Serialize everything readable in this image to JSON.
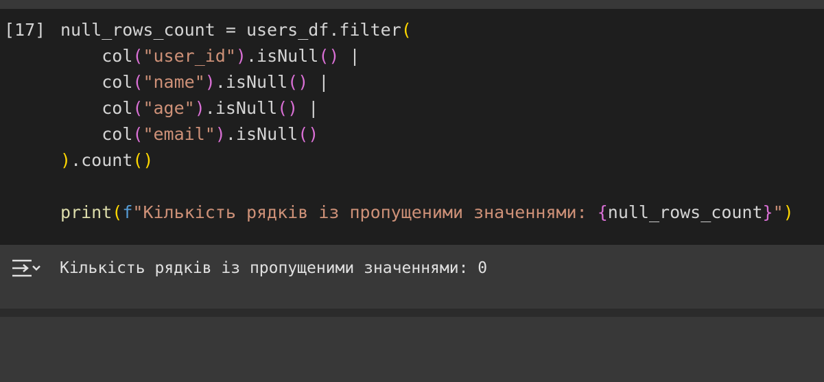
{
  "cell": {
    "execution_count": "[17]",
    "code": {
      "line1": {
        "var": "null_rows_count",
        "assign": " = ",
        "obj": "users_df",
        "dot": ".",
        "method": "filter",
        "open": "("
      },
      "line2": {
        "indent": "    ",
        "fn": "col",
        "open": "(",
        "arg": "\"user_id\"",
        "close": ")",
        "method": ".isNull",
        "call": "()",
        "op": " |"
      },
      "line3": {
        "indent": "    ",
        "fn": "col",
        "open": "(",
        "arg": "\"name\"",
        "close": ")",
        "method": ".isNull",
        "call": "()",
        "op": " |"
      },
      "line4": {
        "indent": "    ",
        "fn": "col",
        "open": "(",
        "arg": "\"age\"",
        "close": ")",
        "method": ".isNull",
        "call": "()",
        "op": " |"
      },
      "line5": {
        "indent": "    ",
        "fn": "col",
        "open": "(",
        "arg": "\"email\"",
        "close": ")",
        "method": ".isNull",
        "call": "()"
      },
      "line6": {
        "close": ")",
        "method": ".count",
        "call": "()"
      },
      "line8": {
        "fn": "print",
        "open": "(",
        "prefix": "f",
        "str_start": "\"Кількість рядків із пропущеними значеннями: ",
        "brace_open": "{",
        "expr": "null_rows_count",
        "brace_close": "}",
        "str_end": "\"",
        "close": ")"
      }
    }
  },
  "output": {
    "icon": "output-expand-icon",
    "text": "Кількість рядків із пропущеними значеннями: 0"
  },
  "colors": {
    "background": "#1e1e1e",
    "output_background": "#383838",
    "string": "#ce9178",
    "function": "#dcdcaa",
    "bracket_level1": "#ffd700",
    "bracket_level2": "#da70d6"
  }
}
